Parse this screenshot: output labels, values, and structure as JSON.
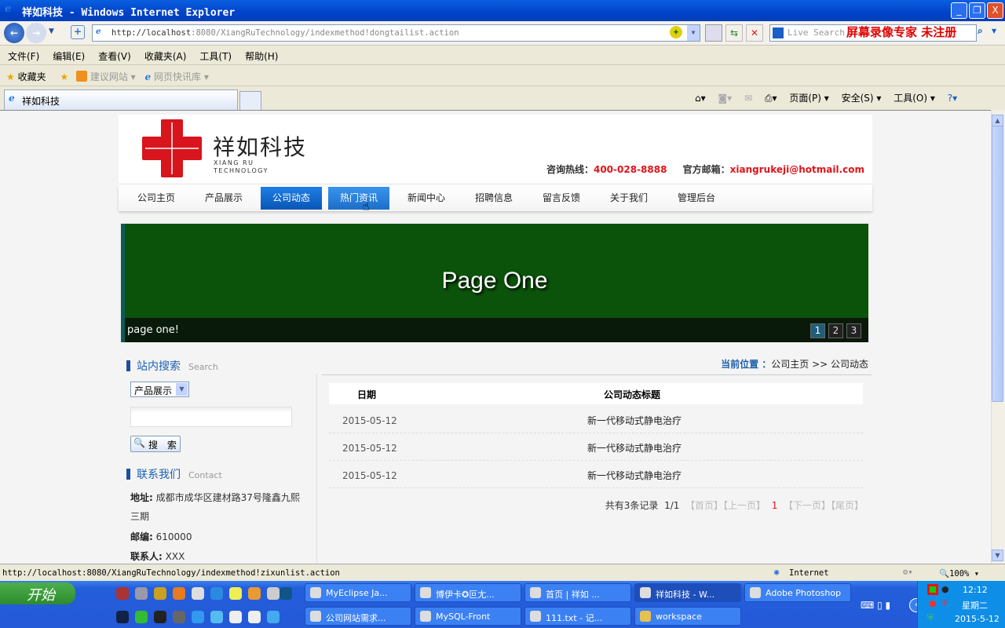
{
  "window": {
    "title": "祥如科技 - Windows Internet Explorer",
    "min": "_",
    "restore": "❐",
    "close": "X"
  },
  "address": {
    "url_host": "http://localhost",
    "url_rest": ":8080/XiangRuTechnology/indexmethod!dongtailist.action"
  },
  "search": {
    "placeholder": "Live Search"
  },
  "watermark": "屏幕录像专家  未注册",
  "menu": [
    "文件(F)",
    "编辑(E)",
    "查看(V)",
    "收藏夹(A)",
    "工具(T)",
    "帮助(H)"
  ],
  "favorites": {
    "label": "收藏夹",
    "items": [
      "建议网站 ▾",
      "网页快讯库 ▾"
    ]
  },
  "tab": {
    "label": "祥如科技"
  },
  "command_bar": [
    "页面(P) ▾",
    "安全(S) ▾",
    "工具(O) ▾"
  ],
  "site": {
    "brand": "祥如科技",
    "brand_en_1": "XIANG RU",
    "brand_en_2": "TECHNOLOGY",
    "hotline_label": "咨询热线：",
    "hotline": "400-028-8888",
    "email_label": "官方邮箱：",
    "email": "xiangrukeji@hotmail.com",
    "nav": [
      "公司主页",
      "产品展示",
      "公司动态",
      "热门资讯",
      "新闻中心",
      "招聘信息",
      "留言反馈",
      "关于我们",
      "管理后台"
    ],
    "nav_active": "公司动态",
    "banner": {
      "title": "Page One",
      "caption": "page one!",
      "pages": [
        "1",
        "2",
        "3"
      ],
      "current_page": "1"
    },
    "search_section": {
      "title": "站内搜索",
      "subtitle": "Search",
      "select_value": "产品展示",
      "input_value": "",
      "button": "搜 索"
    },
    "contact_section": {
      "title": "联系我们",
      "subtitle": "Contact",
      "address_label": "地址:",
      "address": "成都市成华区建材路37号隆鑫九熙",
      "address_2": "三期",
      "zip_label": "邮编:",
      "zip": "610000",
      "person_label": "联系人:",
      "person": "XXX"
    },
    "breadcrumb": {
      "label": "当前位置 ：",
      "path": "公司主页  >> 公司动态"
    },
    "table": {
      "headers": [
        "日期",
        "公司动态标题"
      ],
      "rows": [
        {
          "date": "2015-05-12",
          "title": "新一代移动式静电治疗"
        },
        {
          "date": "2015-05-12",
          "title": "新一代移动式静电治疗"
        },
        {
          "date": "2015-05-12",
          "title": "新一代移动式静电治疗"
        }
      ]
    },
    "pager": {
      "total": "共有3条记录",
      "pages": "1/1",
      "first": "【首页】",
      "prev": "【上一页】",
      "current": "1",
      "next": "【下一页】",
      "last": "【尾页】"
    }
  },
  "status": {
    "url": "http://localhost:8080/XiangRuTechnology/indexmethod!zixunlist.action",
    "zone": "Internet",
    "zoom": "100%"
  },
  "taskbar": {
    "start": "开始",
    "tasks_row1": [
      "MyEclipse Ja...",
      "博伊卡✪叵尢...",
      "首页 | 祥如 ...",
      "祥如科技 - W...",
      "Adobe Photoshop"
    ],
    "tasks_row2": [
      "公司网站需求...",
      "MySQL-Front",
      "111.txt - 记...",
      "workspace"
    ],
    "clock": {
      "time": "12:12",
      "weekday": "星期二",
      "date": "2015-5-12"
    }
  },
  "colors": {
    "brand_red": "#e0141a",
    "nav_active": "#0b62c4",
    "banner_green": "#0b520b",
    "accent_blue": "#1e62b0"
  }
}
